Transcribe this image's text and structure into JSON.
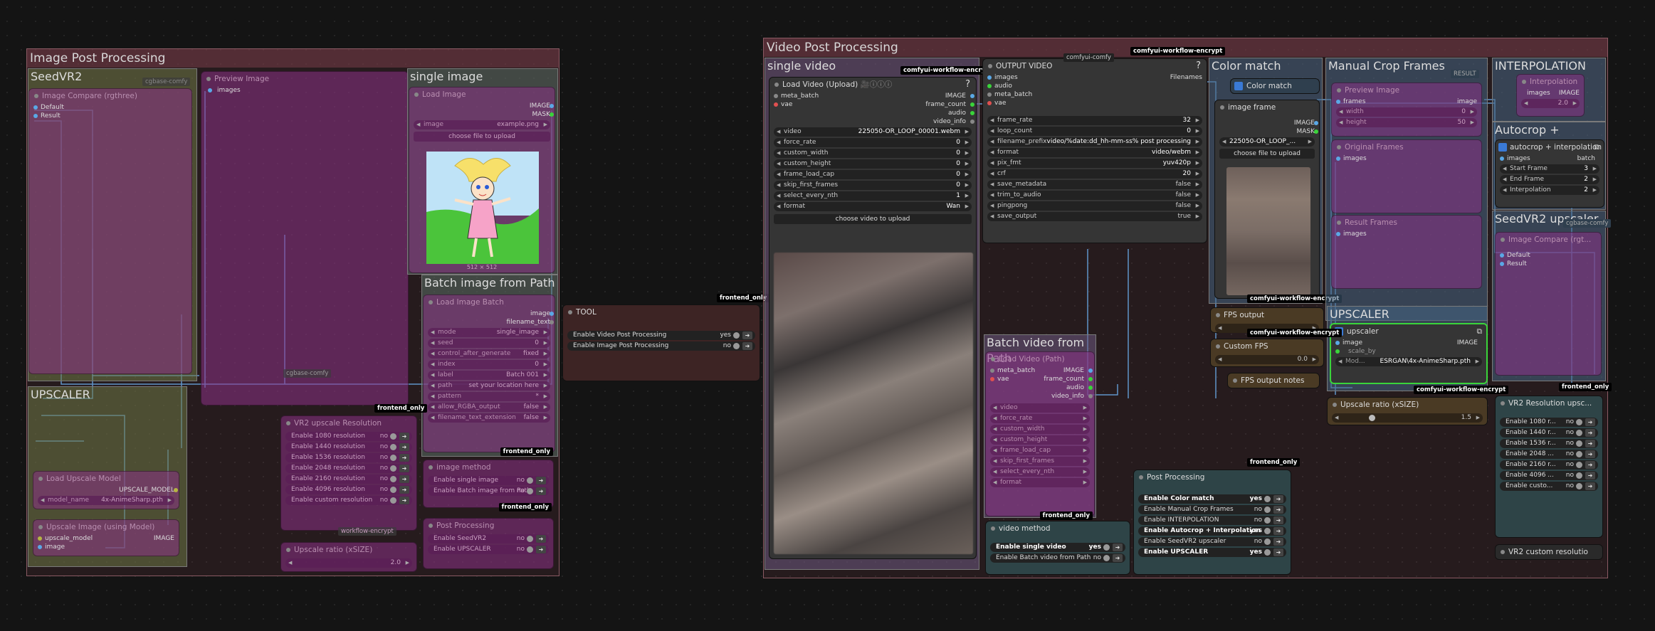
{
  "image_post": {
    "title": "Image Post Processing",
    "seedvr2": {
      "title": "SeedVR2",
      "tag": "cgbase-comfy",
      "node": "Image Compare (rgthree)",
      "in1": "Default",
      "in2": "Result"
    },
    "preview": {
      "title": "Preview Image",
      "in": "images",
      "tag": "cgbase-comfy"
    },
    "single_image": {
      "title": "single image",
      "node": "Load Image",
      "out1": "IMAGE",
      "out2": "MASK",
      "image_field": "example.png",
      "upload": "choose file to upload",
      "caption": "512 × 512"
    },
    "batch_image": {
      "title": "Batch image from Path",
      "node": "Load Image Batch",
      "out1": "image",
      "out2": "filename_text",
      "rows": [
        {
          "k": "mode",
          "v": "single_image"
        },
        {
          "k": "seed",
          "v": "0"
        },
        {
          "k": "control_after_generate",
          "v": "fixed"
        },
        {
          "k": "index",
          "v": "0"
        },
        {
          "k": "label",
          "v": "Batch 001"
        },
        {
          "k": "path",
          "v": "set your location here"
        },
        {
          "k": "pattern",
          "v": "*"
        },
        {
          "k": "allow_RGBA_output",
          "v": "false"
        },
        {
          "k": "filename_text_extension",
          "v": "false"
        }
      ]
    },
    "upscaler": {
      "title": "UPSCALER",
      "load_model": "Load Upscale Model",
      "model_out": "UPSCALE_MODEL",
      "model_name": "4x-AnimeSharp.pth",
      "upscale_node": "Upscale Image (using Model)",
      "in1": "upscale_model",
      "in2": "image",
      "out": "IMAGE"
    },
    "vr2_res": {
      "title": "VR2 upscale Resolution",
      "tag": "workflow-encrypt",
      "rows": [
        "Enable 1080 resolution",
        "Enable 1440 resolution",
        "Enable 1536 resolution",
        "Enable 2048 resolution",
        "Enable 2160 resolution",
        "Enable 4096 resolution",
        "Enable custom resolution"
      ],
      "val": "no"
    },
    "ratio": {
      "title": "Upscale ratio (xSIZE)",
      "val": "2.0"
    },
    "image_method": {
      "title": "image method",
      "rows": [
        {
          "k": "Enable single image",
          "v": "no"
        },
        {
          "k": "Enable Batch image from Path",
          "v": "no"
        }
      ],
      "tag": "frontend_only"
    },
    "processing": {
      "title": "Post Processing",
      "rows": [
        {
          "k": "Enable SeedVR2",
          "v": "no"
        },
        {
          "k": "Enable UPSCALER",
          "v": "no"
        }
      ]
    },
    "frontend_tag": "frontend_only"
  },
  "tool": {
    "title": "TOOL",
    "tag": "frontend_only",
    "rows": [
      {
        "k": "Enable Video Post Processing",
        "v": "yes"
      },
      {
        "k": "Enable Image Post Processing",
        "v": "no"
      }
    ]
  },
  "video_post": {
    "title": "Video Post Processing",
    "enc_tag": "comfyui-workflow-encrypt",
    "single_video": {
      "title": "single video",
      "node": "Load Video (Upload)",
      "icons": "🎥ⓘⓘⓘ",
      "help": "?",
      "inputs": [
        "meta_batch",
        "vae"
      ],
      "outputs": [
        "IMAGE",
        "frame_count",
        "audio",
        "video_info"
      ],
      "widgets": [
        {
          "k": "video",
          "v": "225050-OR_LOOP_00001.webm"
        },
        {
          "k": "force_rate",
          "v": "0"
        },
        {
          "k": "custom_width",
          "v": "0"
        },
        {
          "k": "custom_height",
          "v": "0"
        },
        {
          "k": "frame_load_cap",
          "v": "0"
        },
        {
          "k": "skip_first_frames",
          "v": "0"
        },
        {
          "k": "select_every_nth",
          "v": "1"
        },
        {
          "k": "format",
          "v": "Wan"
        }
      ],
      "upload": "choose video to upload"
    },
    "output_video": {
      "title": "OUTPUT VIDEO",
      "help": "?",
      "inputs": [
        "images",
        "audio",
        "meta_batch",
        "vae"
      ],
      "output": "Filenames",
      "widgets": [
        {
          "k": "frame_rate",
          "v": "32"
        },
        {
          "k": "loop_count",
          "v": "0"
        },
        {
          "k": "filename_prefix",
          "v": "video/%date:dd_hh-mm-ss% post processing"
        },
        {
          "k": "format",
          "v": "video/webm"
        },
        {
          "k": "pix_fmt",
          "v": "yuv420p"
        },
        {
          "k": "crf",
          "v": "20"
        }
      ],
      "toggles": [
        {
          "k": "save_metadata",
          "v": "false"
        },
        {
          "k": "trim_to_audio",
          "v": "false"
        },
        {
          "k": "pingpong",
          "v": "false"
        },
        {
          "k": "save_output",
          "v": "true"
        }
      ],
      "mini_tag": "comfyui-comfy"
    },
    "color_match": {
      "title": "Color match",
      "node": "Color match",
      "image_frame": "image frame",
      "out1": "IMAGE",
      "out2": "MASK",
      "file": "225050-OR_LOOP_...",
      "upload": "choose file to upload"
    },
    "manual_crop": {
      "title": "Manual Crop Frames",
      "node1": "Preview Image",
      "in1": "frames",
      "out1": "image",
      "mini": "RESULT",
      "w_val": "0",
      "h_val": "50",
      "node2": "Original Frames",
      "in2": "images",
      "node3": "Result Frames",
      "in3": "images"
    },
    "interpolation": {
      "title": "INTERPOLATION",
      "node": "Interpolation",
      "in": "images",
      "out": "IMAGE",
      "val": "2.0"
    },
    "autocrop": {
      "title": "Autocrop + Interpolation",
      "node": "autocrop + interpolation",
      "in": "images",
      "out": "batch",
      "widgets": [
        {
          "k": "Start Frame",
          "v": "3"
        },
        {
          "k": "End Frame",
          "v": "2"
        },
        {
          "k": "Interpolation",
          "v": "2"
        }
      ]
    },
    "seedvr2": {
      "title": "SeedVR2 upscaler",
      "tag": "cgbase-comfy",
      "node": "Image Compare (rgt...",
      "in1": "Default",
      "in2": "Result"
    },
    "upscaler": {
      "title": "UPSCALER",
      "node": "upscaler",
      "in1": "image",
      "in2": "scale_by",
      "out": "IMAGE",
      "model": "ESRGAN\\4x-AnimeSharp.pth",
      "model_k": "Mod..."
    },
    "upscale_ratio": {
      "title": "Upscale ratio (xSIZE)",
      "val": "1.5"
    },
    "vr2_res": {
      "title": "VR2 Resolution upsc...",
      "rows": [
        "Enable 1080 r...",
        "Enable 1440 r...",
        "Enable 1536 r...",
        "Enable 2048 ...",
        "Enable 2160 r...",
        "Enable 4096 ...",
        "Enable custo..."
      ],
      "val": "no"
    },
    "vr2_custom": {
      "title": "VR2 custom resolutio"
    },
    "fps_output": {
      "title": "FPS output"
    },
    "custom_fps": {
      "title": "Custom FPS",
      "val": "0.0"
    },
    "fps_notes": {
      "title": "FPS output notes"
    },
    "batch_video": {
      "title": "Batch video from Path",
      "node": "Load Video (Path)",
      "inputs": [
        "meta_batch",
        "vae"
      ],
      "outputs": [
        "IMAGE",
        "frame_count",
        "audio",
        "video_info"
      ],
      "rows": [
        "video",
        "force_rate",
        "custom_width",
        "custom_height",
        "frame_load_cap",
        "skip_first_frames",
        "select_every_nth",
        "format"
      ]
    },
    "video_method": {
      "title": "video method",
      "rows": [
        {
          "k": "Enable single video",
          "v": "yes"
        },
        {
          "k": "Enable Batch video from Path",
          "v": "no"
        }
      ]
    },
    "post_processing": {
      "title": "Post Processing",
      "rows": [
        {
          "k": "Enable Color match",
          "v": "yes"
        },
        {
          "k": "Enable Manual Crop Frames",
          "v": "no"
        },
        {
          "k": "Enable INTERPOLATION",
          "v": "no"
        },
        {
          "k": "Enable Autocrop + Interpolation",
          "v": "yes"
        },
        {
          "k": "Enable SeedVR2 upscaler",
          "v": "no"
        },
        {
          "k": "Enable UPSCALER",
          "v": "yes"
        }
      ]
    },
    "frontend_tag": "frontend_only"
  },
  "colors": {
    "bg": "#141414",
    "group_border": "#8a5a63",
    "node": "#353535",
    "purple_node": "#8c3287",
    "wire": "#5aa8e6",
    "green_out": "#3ad43a"
  }
}
